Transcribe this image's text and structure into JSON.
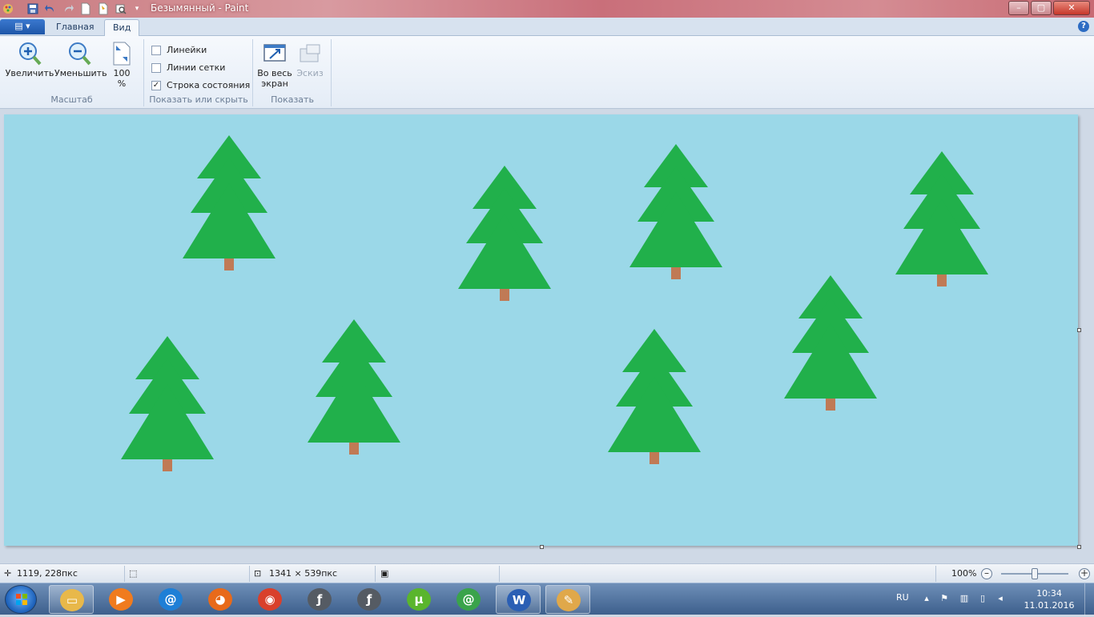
{
  "window": {
    "title": "Безымянный - Paint",
    "minimize": "–",
    "maximize": "▢",
    "close": "✕"
  },
  "tabs": [
    {
      "label": "Главная",
      "active": false
    },
    {
      "label": "Вид",
      "active": true
    }
  ],
  "ribbon": {
    "zoom_group": {
      "label": "Масштаб",
      "zoom_in": "Увеличить",
      "zoom_out": "Уменьшить",
      "hundred_line1": "100",
      "hundred_line2": "%"
    },
    "show_hide_group": {
      "label": "Показать или скрыть",
      "rulers": {
        "label": "Линейки",
        "checked": false
      },
      "gridlines": {
        "label": "Линии сетки",
        "checked": false
      },
      "status_bar": {
        "label": "Строка состояния",
        "checked": true
      }
    },
    "display_group": {
      "label": "Показать",
      "fullscreen_line1": "Во весь",
      "fullscreen_line2": "экран",
      "thumbnail": "Эскиз"
    }
  },
  "canvas": {
    "background_color": "#9bd8e8",
    "tree_color": "#21b04b",
    "trunk_color": "#c07a55",
    "tree_count": 8
  },
  "statusbar": {
    "cursor_position": "1119, 228пкс",
    "image_size": "1341 × 539пкс",
    "zoom_level": "100%",
    "zoom_out_symbol": "–",
    "zoom_in_symbol": "+"
  },
  "taskbar": {
    "items": [
      {
        "name": "explorer",
        "glyph": "▭",
        "color": "#e8b84a",
        "open": true
      },
      {
        "name": "media-player",
        "glyph": "▶",
        "color": "#f07b1e",
        "open": false
      },
      {
        "name": "mail-agent",
        "glyph": "@",
        "color": "#1e7fd6",
        "open": false
      },
      {
        "name": "firefox",
        "glyph": "◕",
        "color": "#e86a1a",
        "open": false
      },
      {
        "name": "chrome",
        "glyph": "◉",
        "color": "#d9402b",
        "open": false
      },
      {
        "name": "flash-1",
        "glyph": "ƒ",
        "color": "#555b63",
        "open": false
      },
      {
        "name": "flash-2",
        "glyph": "ƒ",
        "color": "#555b63",
        "open": false
      },
      {
        "name": "utorrent",
        "glyph": "µ",
        "color": "#5ab52d",
        "open": false
      },
      {
        "name": "icq-agent",
        "glyph": "@",
        "color": "#3aa34b",
        "open": false
      },
      {
        "name": "word",
        "glyph": "W",
        "color": "#2b5fb4",
        "open": true
      },
      {
        "name": "paint",
        "glyph": "✎",
        "color": "#e0a84a",
        "open": true
      }
    ],
    "language": "RU",
    "time": "10:34",
    "date": "11.01.2016"
  }
}
